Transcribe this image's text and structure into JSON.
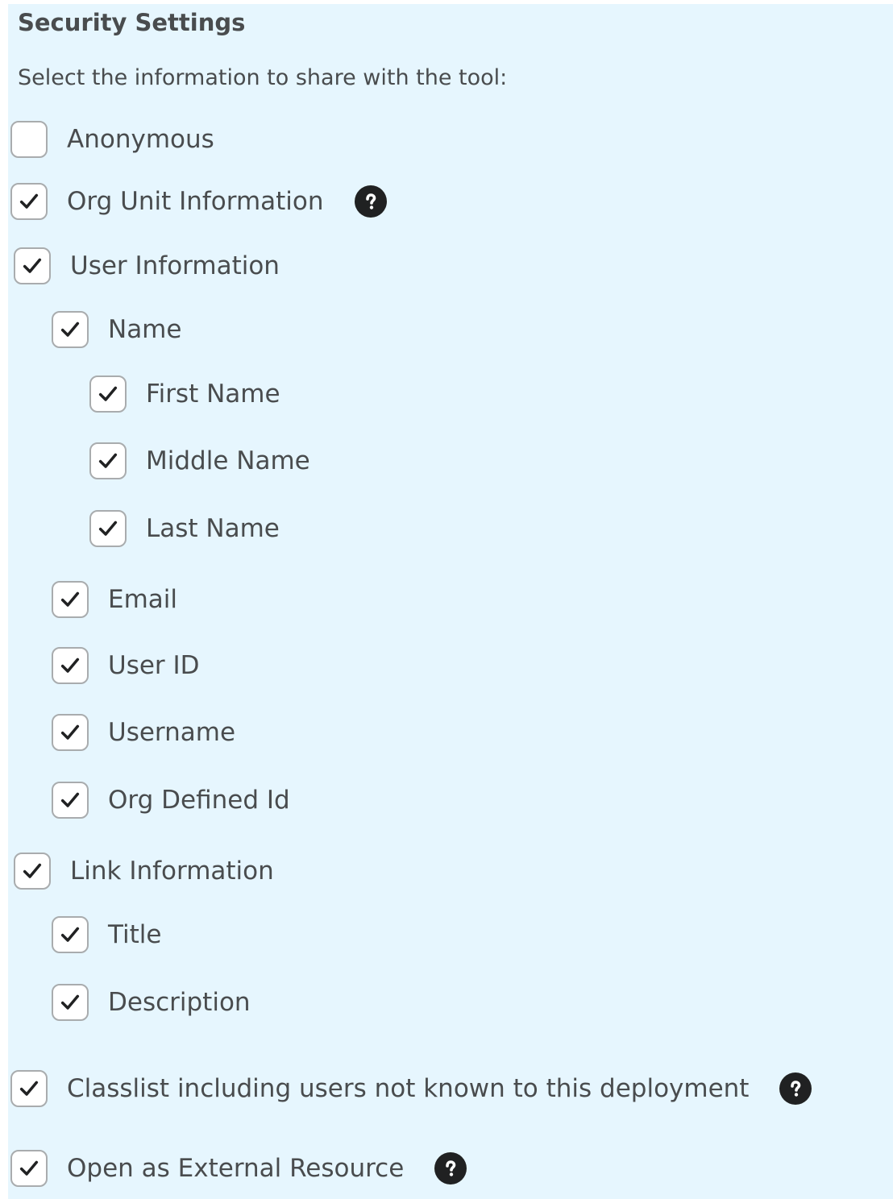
{
  "section": {
    "title": "Security Settings",
    "instruction": "Select the information to share with the tool:"
  },
  "options": {
    "anonymous": {
      "label": "Anonymous",
      "checked": false
    },
    "org_unit_information": {
      "label": "Org Unit Information",
      "checked": true
    },
    "user_information": {
      "label": "User Information",
      "checked": true
    },
    "name": {
      "label": "Name",
      "checked": true
    },
    "first_name": {
      "label": "First Name",
      "checked": true
    },
    "middle_name": {
      "label": "Middle Name",
      "checked": true
    },
    "last_name": {
      "label": "Last Name",
      "checked": true
    },
    "email": {
      "label": "Email",
      "checked": true
    },
    "user_id": {
      "label": "User ID",
      "checked": true
    },
    "username": {
      "label": "Username",
      "checked": true
    },
    "org_defined_id": {
      "label": "Org Defined Id",
      "checked": true
    },
    "link_information": {
      "label": "Link Information",
      "checked": true
    },
    "title": {
      "label": "Title",
      "checked": true
    },
    "description": {
      "label": "Description",
      "checked": true
    },
    "classlist": {
      "label": "Classlist including users not known to this deployment",
      "checked": true
    },
    "open_external": {
      "label": "Open as External Resource",
      "checked": true
    }
  },
  "icons": {
    "checkmark": "checkmark-icon",
    "help": "help-icon"
  },
  "colors": {
    "panel_background": "#e6f6fe",
    "text": "#494c4e",
    "checkbox_border": "#a9acae",
    "help_icon": "#202122"
  }
}
